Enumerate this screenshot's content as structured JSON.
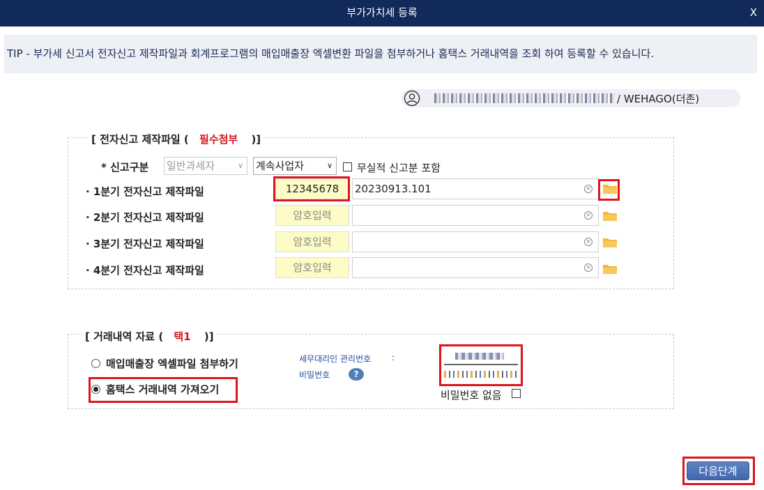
{
  "window": {
    "title": "부가가치세 등록",
    "close_label": "X"
  },
  "tip": {
    "text": "TIP - 부가세 신고서 전자신고 제작파일과 회계프로그램의 매입매출장 엑셀변환 파일을 첨부하거나 홈택스 거래내역을 조회 하여 등록할 수 있습니다."
  },
  "user": {
    "org_label": "/ WEHAGO(더존)"
  },
  "efile": {
    "legend_prefix": "[ 전자신고 제작파일 (",
    "legend_required": "필수첨부",
    "legend_suffix": ")]",
    "report_type_label": "* 신고구분",
    "taxpayer_type": "일반과세자",
    "business_type": "계속사업자",
    "include_no_activity_label": "무실적 신고분 포함",
    "rows": [
      {
        "label": "· 1분기 전자신고 제작파일",
        "password": "12345678",
        "file": "20230913.101"
      },
      {
        "label": "· 2분기 전자신고 제작파일",
        "password": "암호입력",
        "file": ""
      },
      {
        "label": "· 3분기 전자신고 제작파일",
        "password": "암호입력",
        "file": ""
      },
      {
        "label": "· 4분기 전자신고 제작파일",
        "password": "암호입력",
        "file": ""
      }
    ]
  },
  "trade": {
    "legend_prefix": "[ 거래내역 자료 (",
    "legend_required": "택1",
    "legend_suffix": ")]",
    "option_excel": "매입매출장 엑셀파일 첨부하기",
    "option_hometax": "홈택스 거래내역 가져오기",
    "agent_no_label": "세무대리인 관리번호",
    "colon": ":",
    "password_label": "비밀번호",
    "help_label": "?",
    "no_password_label": "비밀번호 없음"
  },
  "footer": {
    "next_label": "다음단계"
  },
  "colors": {
    "titlebar": "#122a5a",
    "highlight": "#e0141b",
    "password_field": "#fdfbc6",
    "primary_button": "#4a6fb3"
  }
}
